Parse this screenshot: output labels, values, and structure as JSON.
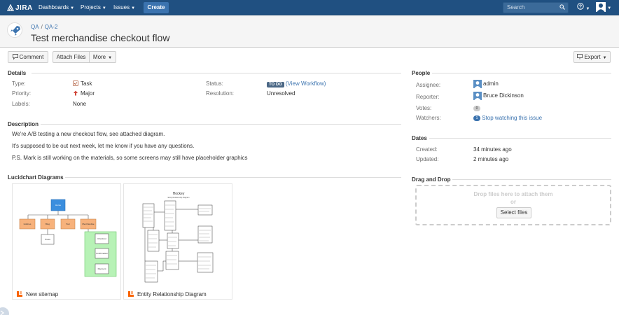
{
  "nav": {
    "logo": "JIRA",
    "dashboards": "Dashboards",
    "projects": "Projects",
    "issues": "Issues",
    "create": "Create",
    "search_placeholder": "Search"
  },
  "header": {
    "project_key": "QA",
    "issue_key": "QA-2",
    "summary": "Test merchandise checkout flow"
  },
  "toolbar": {
    "comment": "Comment",
    "attach_files": "Attach Files",
    "more": "More",
    "export": "Export"
  },
  "details": {
    "title": "Details",
    "type_label": "Type:",
    "type_value": "Task",
    "priority_label": "Priority:",
    "priority_value": "Major",
    "labels_label": "Labels:",
    "labels_value": "None",
    "status_label": "Status:",
    "status_badge": "TO DO",
    "view_workflow": "(View Workflow)",
    "resolution_label": "Resolution:",
    "resolution_value": "Unresolved"
  },
  "description": {
    "title": "Description",
    "lines": [
      "We're A/B testing a new checkout flow, see attached diagram.",
      "It's supposed to be out next week, let me know if you have any questions.",
      "P.S. Mark is still working on the materials, so some screens may still have placeholder graphics"
    ]
  },
  "lucidchart": {
    "title": "Lucidchart Diagrams",
    "diagrams": [
      {
        "name": "New sitemap",
        "nodes": [
          "Home",
          "Hotlines",
          "Blog",
          "Tour",
          "Merchandise",
          "Press",
          "Checkout",
          "Confirmation",
          "Payment"
        ]
      },
      {
        "name": "Entity Relationship Diagram",
        "heading": "Hockey",
        "subheading": "Entity Relationship Diagram"
      }
    ]
  },
  "people": {
    "title": "People",
    "assignee_label": "Assignee:",
    "assignee_value": "admin",
    "reporter_label": "Reporter:",
    "reporter_value": "Bruce Dickinson",
    "votes_label": "Votes:",
    "votes_count": "0",
    "watchers_label": "Watchers:",
    "watchers_count": "1",
    "watch_link": "Stop watching this issue"
  },
  "dates": {
    "title": "Dates",
    "created_label": "Created:",
    "created_value": "34 minutes ago",
    "updated_label": "Updated:",
    "updated_value": "2 minutes ago"
  },
  "dragdrop": {
    "title": "Drag and Drop",
    "drop_text": "Drop files here to attach them",
    "or_text": "or",
    "select_files": "Select files"
  },
  "colors": {
    "nav_bg": "#205081",
    "create_btn": "#3b73af",
    "link": "#3b73af",
    "todo_badge": "#4a6785",
    "sitemap_root": "#3b8ede",
    "sitemap_orange": "#f7b27c",
    "sitemap_green": "#b7f2b6"
  }
}
